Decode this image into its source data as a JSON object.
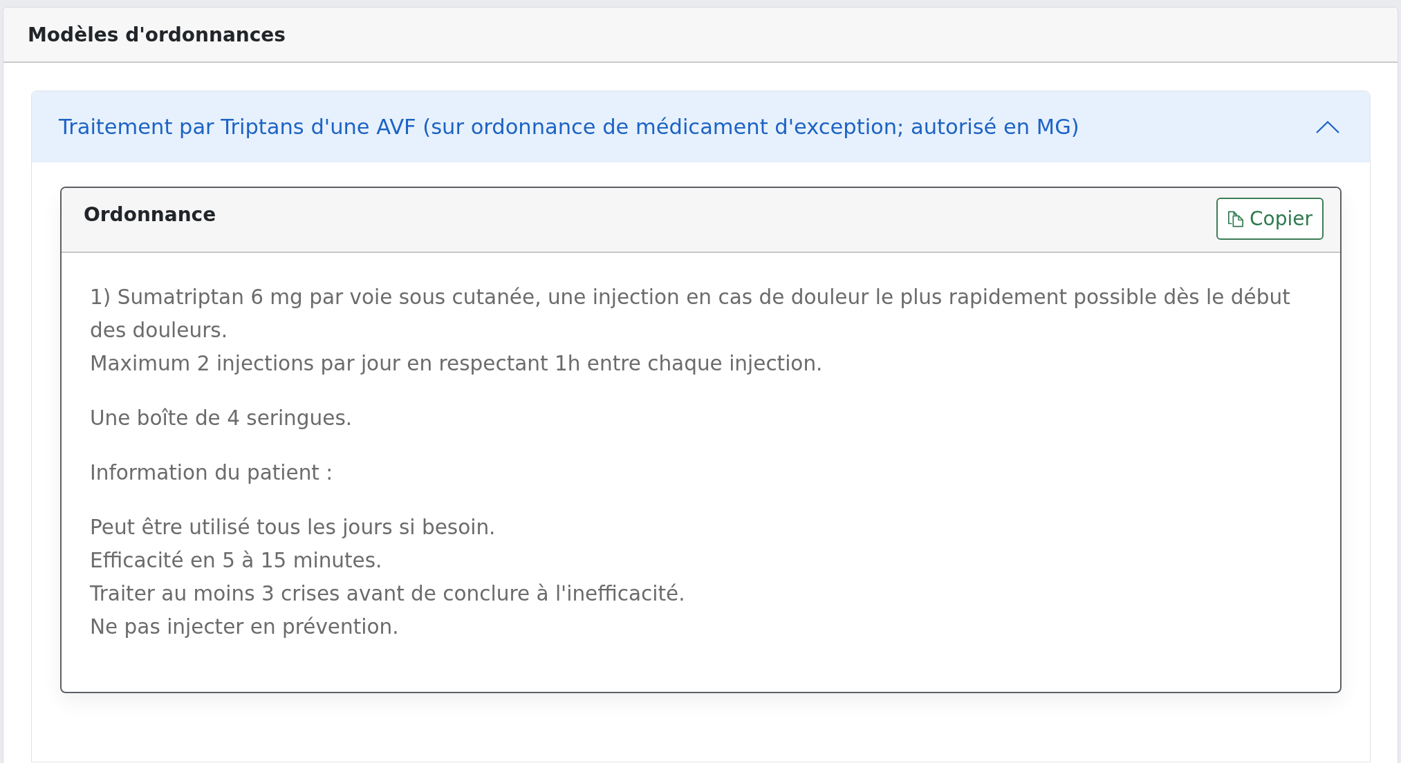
{
  "panel": {
    "title": "Modèles d'ordonnances"
  },
  "accordion": {
    "title": "Traitement par Triptans d'une AVF (sur ordonnance de médicament d'exception; autorisé en MG)",
    "expanded": true,
    "card": {
      "title": "Ordonnance",
      "copy_button": "Copier",
      "paragraphs": [
        {
          "lines": [
            "1) Sumatriptan 6 mg par voie sous cutanée, une injection en cas de douleur le plus rapidement possible dès le début des douleurs.",
            "Maximum 2 injections par jour en respectant 1h entre chaque injection."
          ]
        },
        {
          "lines": [
            "Une boîte de 4 seringues."
          ]
        },
        {
          "lines": [
            "Information du patient :"
          ]
        },
        {
          "lines": [
            "Peut être utilisé tous les jours si besoin.",
            "Efficacité en 5 à 15 minutes.",
            "Traiter au moins 3 crises avant de conclure à l'inefficacité.",
            "Ne pas injecter en prévention."
          ]
        }
      ]
    }
  }
}
